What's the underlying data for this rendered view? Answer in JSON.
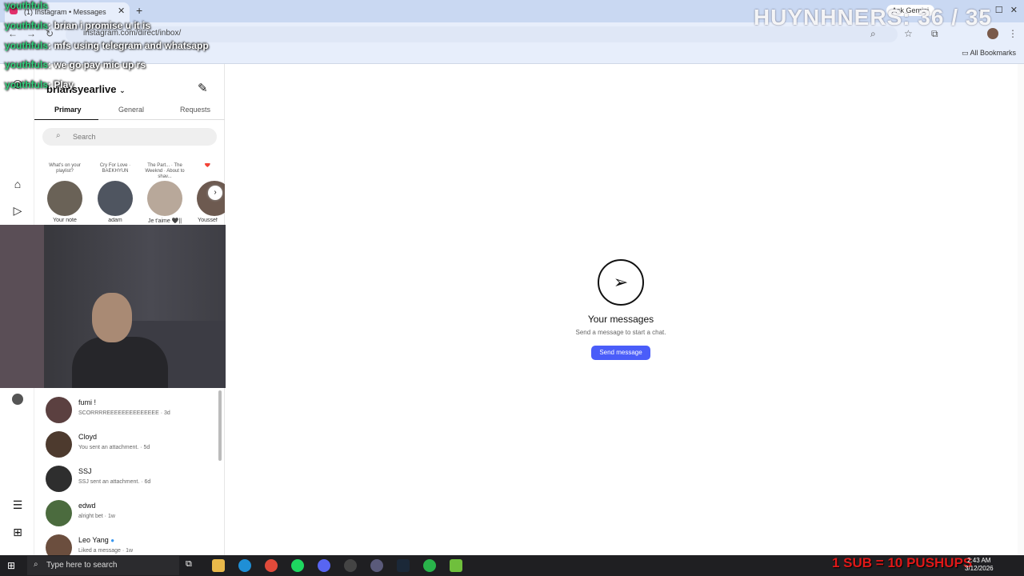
{
  "browser": {
    "tab_title": "(1) Instagram • Messages",
    "url": "instagram.com/direct/inbox/",
    "all_bookmarks": "All Bookmarks",
    "ask_gemini": "Ask Gemini"
  },
  "stream": {
    "chat": [
      {
        "user": "youthfuls",
        "msg": ""
      },
      {
        "user": "youthfuls",
        "msg": ": brian i promise u it is"
      },
      {
        "user": "youthfuls",
        "msg": ": mfs using telegram and whatsapp"
      },
      {
        "user": "youthfuls",
        "msg": ": we go pay mic up rs"
      },
      {
        "user": "youthfuls",
        "msg": ": Play"
      }
    ],
    "counter": "HUYNHNERS: 36 / 35",
    "sub_goal": "1 SUB = 10 PUSHUPS"
  },
  "inbox": {
    "username": "briansyearlive",
    "tabs": [
      "Primary",
      "General",
      "Requests"
    ],
    "search_placeholder": "Search",
    "stories": [
      {
        "note": "What's on your playlist?",
        "name": "Your note",
        "color": "#6a6257"
      },
      {
        "note": "Cry For Love · BAEKHYUN",
        "name": "adam",
        "color": "#4f5560"
      },
      {
        "note": "The Part... · The Weeknd · About to shav...",
        "name": "Je t'aime 🖤||",
        "color": "#b8a89a"
      },
      {
        "note": "❤️",
        "name": "Youssef",
        "color": "#6d5a50"
      }
    ],
    "conversations": [
      {
        "name": "fumi !",
        "preview": "SCORRRREEEEEEEEEEEEEE · 3d",
        "color": "#5b4040"
      },
      {
        "name": "Cloyd",
        "preview": "You sent an attachment. · 5d",
        "color": "#4d3a2e"
      },
      {
        "name": "SSJ",
        "preview": "SSJ sent an attachment. · 6d",
        "color": "#2e2e2e"
      },
      {
        "name": "edwd",
        "preview": "alright bet · 1w",
        "color": "#4b6b3e"
      },
      {
        "name": "Leo Yang",
        "preview": "Liked a message · 1w",
        "color": "#6b4e3e"
      }
    ]
  },
  "main": {
    "title": "Your messages",
    "subtitle": "Send a message to start a chat.",
    "button": "Send message"
  },
  "taskbar": {
    "search_placeholder": "Type here to search",
    "time": "2:43 AM",
    "date": "3/12/2026"
  },
  "colors": {
    "accent": "#4a5df9",
    "chat_user": "#2fd07a",
    "sub_goal": "#e01818"
  }
}
